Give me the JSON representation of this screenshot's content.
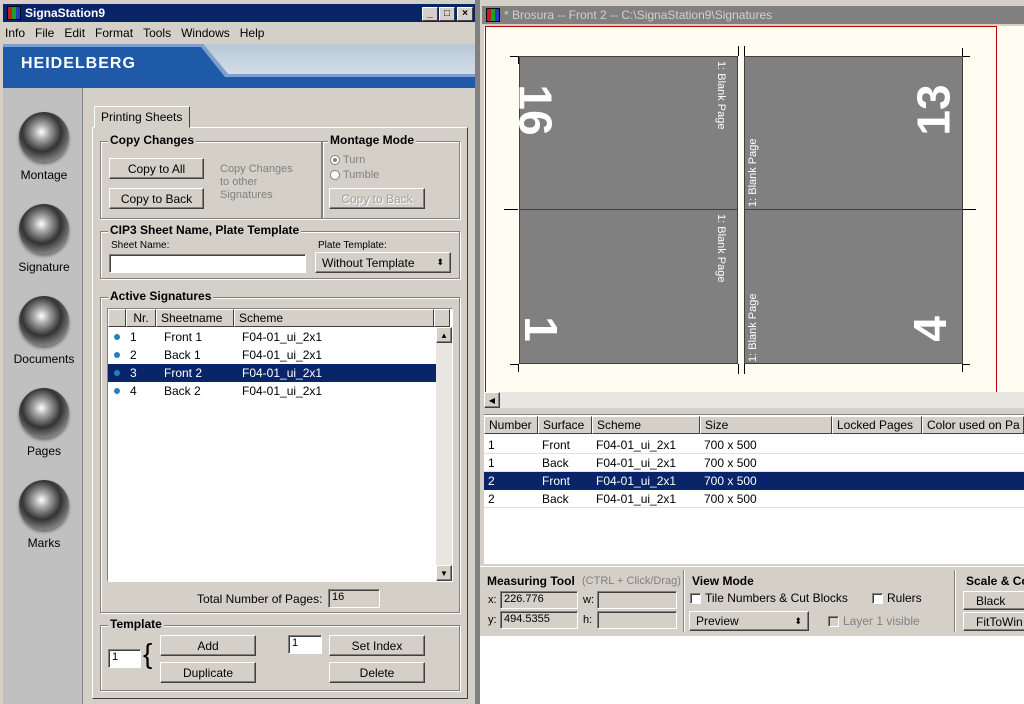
{
  "left_window": {
    "title": "SignaStation9",
    "menu": [
      "Info",
      "File",
      "Edit",
      "Format",
      "Tools",
      "Windows",
      "Help"
    ],
    "brand": "HEIDELBERG",
    "sidebar": [
      "Montage",
      "Signature",
      "Documents",
      "Pages",
      "Marks"
    ],
    "tab": "Printing Sheets",
    "copy_changes": {
      "title": "Copy Changes",
      "copy_to_all": "Copy to All",
      "copy_to_back": "Copy to Back",
      "note": [
        "Copy Changes",
        "to other",
        "Signatures"
      ]
    },
    "montage_mode": {
      "title": "Montage Mode",
      "options": [
        "Turn",
        "Tumble"
      ],
      "copy_to_back": "Copy to Back"
    },
    "cip3": {
      "title": "CIP3 Sheet Name, Plate Template",
      "sheet_name_label": "Sheet Name:",
      "sheet_name_value": "",
      "plate_template_label": "Plate Template:",
      "plate_template_value": "Without Template"
    },
    "active_signatures": {
      "title": "Active Signatures",
      "columns": [
        "Nr.",
        "Sheetname",
        "Scheme"
      ],
      "rows": [
        {
          "nr": "1",
          "sheet": "Front 1",
          "scheme": "F04-01_ui_2x1"
        },
        {
          "nr": "2",
          "sheet": "Back 1",
          "scheme": "F04-01_ui_2x1"
        },
        {
          "nr": "3",
          "sheet": "Front 2",
          "scheme": "F04-01_ui_2x1"
        },
        {
          "nr": "4",
          "sheet": "Back 2",
          "scheme": "F04-01_ui_2x1"
        }
      ],
      "selected_index": 2,
      "total_label": "Total Number of Pages:",
      "total_value": "16"
    },
    "template": {
      "title": "Template",
      "count1": "1",
      "add": "Add",
      "duplicate": "Duplicate",
      "count2": "1",
      "set_index": "Set Index",
      "delete": "Delete"
    }
  },
  "right_window": {
    "title": "* Brosura  -- Front 2 -- C:\\SignaStation9\\Signatures",
    "pages": [
      {
        "num": "16",
        "blank": "1: Blank Page"
      },
      {
        "num": "13",
        "blank": "1: Blank Page"
      },
      {
        "num": "1",
        "blank": "1: Blank Page"
      },
      {
        "num": "4",
        "blank": "1: Blank Page"
      }
    ],
    "table": {
      "columns": [
        "Number",
        "Surface",
        "Scheme",
        "Size",
        "Locked Pages",
        "Color used on Pa"
      ],
      "rows": [
        {
          "number": "1",
          "surface": "Front",
          "scheme": "F04-01_ui_2x1",
          "size": "700 x 500"
        },
        {
          "number": "1",
          "surface": "Back",
          "scheme": "F04-01_ui_2x1",
          "size": "700 x 500"
        },
        {
          "number": "2",
          "surface": "Front",
          "scheme": "F04-01_ui_2x1",
          "size": "700 x 500"
        },
        {
          "number": "2",
          "surface": "Back",
          "scheme": "F04-01_ui_2x1",
          "size": "700 x 500"
        }
      ],
      "selected_index": 2
    },
    "measuring": {
      "title": "Measuring Tool",
      "hint": "(CTRL + Click/Drag)",
      "x_label": "x:",
      "x_value": "226.776",
      "y_label": "y:",
      "y_value": "494.5355",
      "w_label": "w:",
      "w_value": "",
      "h_label": "h:",
      "h_value": ""
    },
    "view_mode": {
      "title": "View Mode",
      "tile_numbers": "Tile Numbers & Cut Blocks",
      "rulers": "Rulers",
      "preview": "Preview",
      "layer_visible": "Layer 1 visible"
    },
    "scale": {
      "title": "Scale & Co",
      "black": "Black",
      "fit": "FitToWin"
    }
  }
}
